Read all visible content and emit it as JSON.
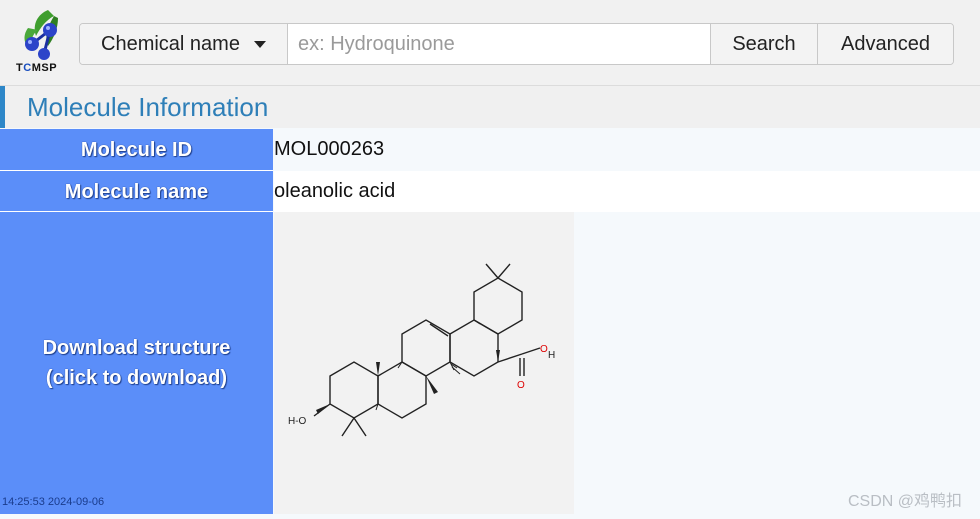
{
  "header": {
    "logo_text": "TCMSP",
    "search_type": "Chemical name",
    "search_placeholder": "ex: Hydroquinone",
    "search_value": "",
    "search_button": "Search",
    "advanced_button": "Advanced"
  },
  "section": {
    "title": "Molecule Information"
  },
  "molecule": {
    "id_label": "Molecule ID",
    "id_value": "MOL000263",
    "name_label": "Molecule name",
    "name_value": "oleanolic acid",
    "download_label_line1": "Download structure",
    "download_label_line2": "(click to download)"
  },
  "structure_atoms": {
    "oh_left": "H-O",
    "h": "H",
    "o": "O",
    "h2": "H"
  },
  "footer": {
    "timestamp": "14:25:53 2024-09-06",
    "watermark": "CSDN @鸡鸭扣"
  },
  "colors": {
    "label_bg": "#5b8ef9",
    "title_text": "#2e7fb8",
    "title_bar": "#2e87c8"
  },
  "icons": {
    "logo": "tcmsp-logo-icon",
    "dropdown": "caret-down-icon"
  }
}
